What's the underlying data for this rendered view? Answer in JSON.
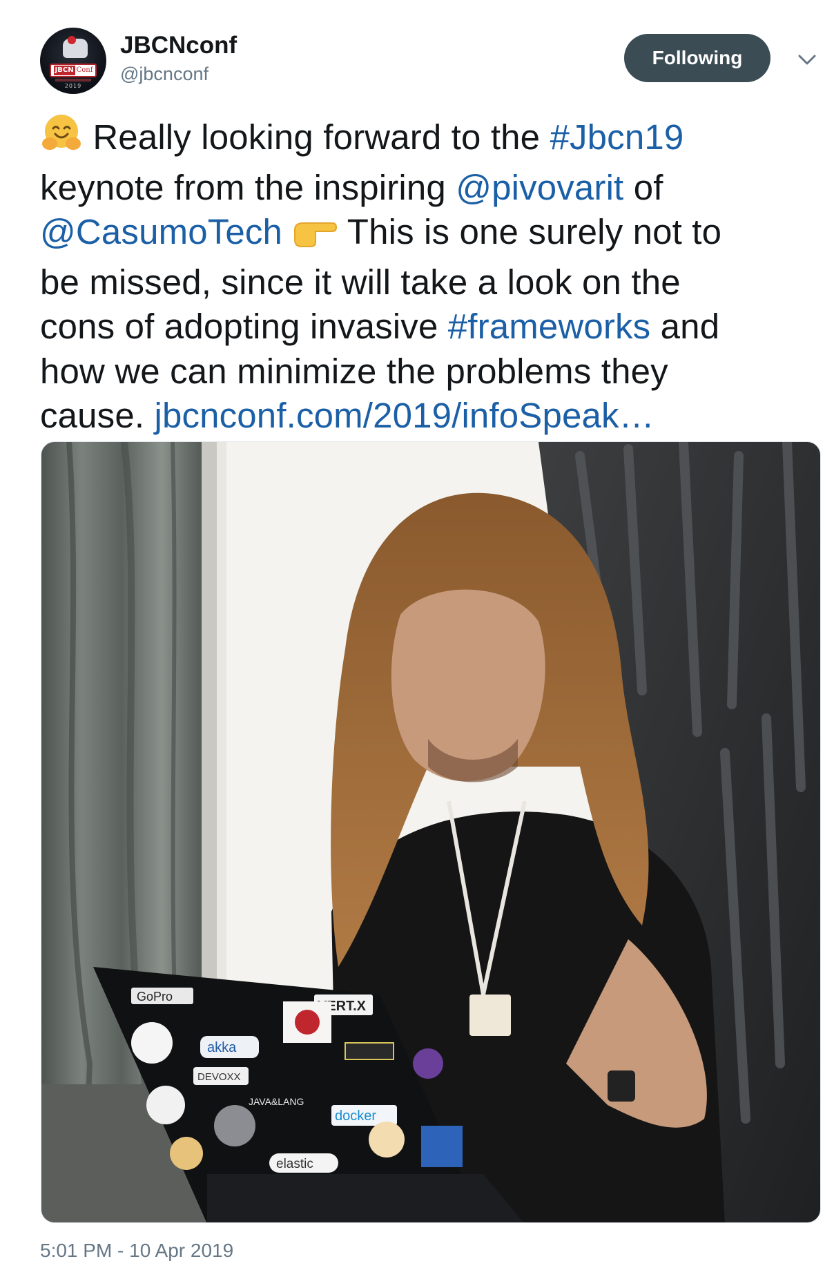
{
  "account": {
    "display_name": "JBCNconf",
    "handle": "@jbcnconf",
    "avatar_badge_left": "JBCN",
    "avatar_badge_right": "Conf",
    "avatar_year": "2019"
  },
  "follow_button": {
    "label": "Following"
  },
  "tweet": {
    "lines": [
      [
        {
          "t": "emoji",
          "icon": "hugging-face-emoji"
        },
        {
          "t": "text",
          "v": " Really looking forward to the "
        },
        {
          "t": "link",
          "v": "#Jbcn19"
        }
      ],
      [
        {
          "t": "text",
          "v": "keynote from the inspiring "
        },
        {
          "t": "link",
          "v": "@pivovarit"
        },
        {
          "t": "text",
          "v": " of"
        }
      ],
      [
        {
          "t": "link",
          "v": "@CasumoTech"
        },
        {
          "t": "text",
          "v": " "
        },
        {
          "t": "emoji",
          "icon": "pointing-right-emoji"
        },
        {
          "t": "text",
          "v": " This is one surely not to"
        }
      ],
      [
        {
          "t": "text",
          "v": "be missed, since it will take a look on the"
        }
      ],
      [
        {
          "t": "text",
          "v": "cons of adopting invasive "
        },
        {
          "t": "link",
          "v": "#frameworks"
        },
        {
          "t": "text",
          "v": " and"
        }
      ],
      [
        {
          "t": "text",
          "v": "how we can minimize the problems they"
        }
      ],
      [
        {
          "t": "text",
          "v": "cause. "
        },
        {
          "t": "link",
          "v": "jbcnconf.com/2019/infoSpeak…"
        }
      ]
    ]
  },
  "photo": {
    "stickers": [
      "GoPro",
      "VERT.X",
      "akka",
      "docker",
      "elastic",
      "JAVA&LANG",
      "DEVOXX"
    ]
  },
  "timestamp": "5:01 PM - 10 Apr 2019",
  "colors": {
    "link": "#1b5fa6",
    "text": "#14171a",
    "muted": "#657786",
    "button": "#3b4c55"
  }
}
